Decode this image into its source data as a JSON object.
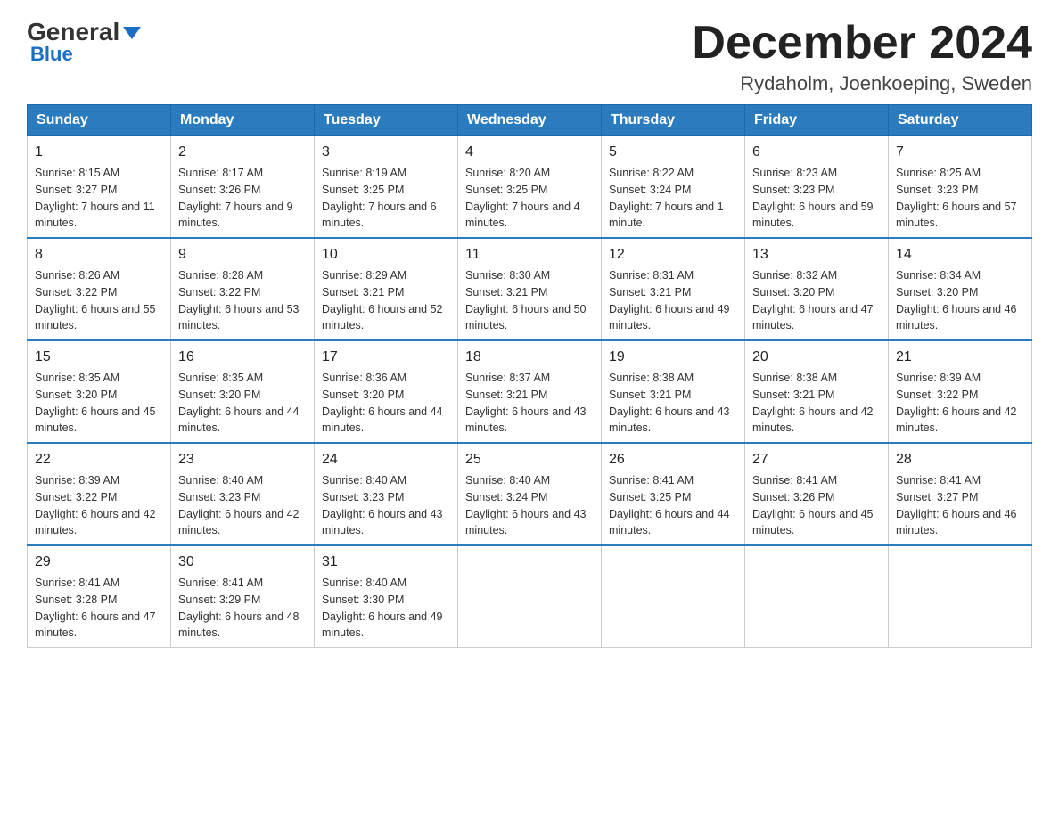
{
  "header": {
    "logo_general": "General",
    "logo_blue": "Blue",
    "main_title": "December 2024",
    "subtitle": "Rydaholm, Joenkoeping, Sweden"
  },
  "calendar": {
    "days_of_week": [
      "Sunday",
      "Monday",
      "Tuesday",
      "Wednesday",
      "Thursday",
      "Friday",
      "Saturday"
    ],
    "weeks": [
      [
        {
          "day": "1",
          "sunrise": "8:15 AM",
          "sunset": "3:27 PM",
          "daylight": "7 hours and 11 minutes."
        },
        {
          "day": "2",
          "sunrise": "8:17 AM",
          "sunset": "3:26 PM",
          "daylight": "7 hours and 9 minutes."
        },
        {
          "day": "3",
          "sunrise": "8:19 AM",
          "sunset": "3:25 PM",
          "daylight": "7 hours and 6 minutes."
        },
        {
          "day": "4",
          "sunrise": "8:20 AM",
          "sunset": "3:25 PM",
          "daylight": "7 hours and 4 minutes."
        },
        {
          "day": "5",
          "sunrise": "8:22 AM",
          "sunset": "3:24 PM",
          "daylight": "7 hours and 1 minute."
        },
        {
          "day": "6",
          "sunrise": "8:23 AM",
          "sunset": "3:23 PM",
          "daylight": "6 hours and 59 minutes."
        },
        {
          "day": "7",
          "sunrise": "8:25 AM",
          "sunset": "3:23 PM",
          "daylight": "6 hours and 57 minutes."
        }
      ],
      [
        {
          "day": "8",
          "sunrise": "8:26 AM",
          "sunset": "3:22 PM",
          "daylight": "6 hours and 55 minutes."
        },
        {
          "day": "9",
          "sunrise": "8:28 AM",
          "sunset": "3:22 PM",
          "daylight": "6 hours and 53 minutes."
        },
        {
          "day": "10",
          "sunrise": "8:29 AM",
          "sunset": "3:21 PM",
          "daylight": "6 hours and 52 minutes."
        },
        {
          "day": "11",
          "sunrise": "8:30 AM",
          "sunset": "3:21 PM",
          "daylight": "6 hours and 50 minutes."
        },
        {
          "day": "12",
          "sunrise": "8:31 AM",
          "sunset": "3:21 PM",
          "daylight": "6 hours and 49 minutes."
        },
        {
          "day": "13",
          "sunrise": "8:32 AM",
          "sunset": "3:20 PM",
          "daylight": "6 hours and 47 minutes."
        },
        {
          "day": "14",
          "sunrise": "8:34 AM",
          "sunset": "3:20 PM",
          "daylight": "6 hours and 46 minutes."
        }
      ],
      [
        {
          "day": "15",
          "sunrise": "8:35 AM",
          "sunset": "3:20 PM",
          "daylight": "6 hours and 45 minutes."
        },
        {
          "day": "16",
          "sunrise": "8:35 AM",
          "sunset": "3:20 PM",
          "daylight": "6 hours and 44 minutes."
        },
        {
          "day": "17",
          "sunrise": "8:36 AM",
          "sunset": "3:20 PM",
          "daylight": "6 hours and 44 minutes."
        },
        {
          "day": "18",
          "sunrise": "8:37 AM",
          "sunset": "3:21 PM",
          "daylight": "6 hours and 43 minutes."
        },
        {
          "day": "19",
          "sunrise": "8:38 AM",
          "sunset": "3:21 PM",
          "daylight": "6 hours and 43 minutes."
        },
        {
          "day": "20",
          "sunrise": "8:38 AM",
          "sunset": "3:21 PM",
          "daylight": "6 hours and 42 minutes."
        },
        {
          "day": "21",
          "sunrise": "8:39 AM",
          "sunset": "3:22 PM",
          "daylight": "6 hours and 42 minutes."
        }
      ],
      [
        {
          "day": "22",
          "sunrise": "8:39 AM",
          "sunset": "3:22 PM",
          "daylight": "6 hours and 42 minutes."
        },
        {
          "day": "23",
          "sunrise": "8:40 AM",
          "sunset": "3:23 PM",
          "daylight": "6 hours and 42 minutes."
        },
        {
          "day": "24",
          "sunrise": "8:40 AM",
          "sunset": "3:23 PM",
          "daylight": "6 hours and 43 minutes."
        },
        {
          "day": "25",
          "sunrise": "8:40 AM",
          "sunset": "3:24 PM",
          "daylight": "6 hours and 43 minutes."
        },
        {
          "day": "26",
          "sunrise": "8:41 AM",
          "sunset": "3:25 PM",
          "daylight": "6 hours and 44 minutes."
        },
        {
          "day": "27",
          "sunrise": "8:41 AM",
          "sunset": "3:26 PM",
          "daylight": "6 hours and 45 minutes."
        },
        {
          "day": "28",
          "sunrise": "8:41 AM",
          "sunset": "3:27 PM",
          "daylight": "6 hours and 46 minutes."
        }
      ],
      [
        {
          "day": "29",
          "sunrise": "8:41 AM",
          "sunset": "3:28 PM",
          "daylight": "6 hours and 47 minutes."
        },
        {
          "day": "30",
          "sunrise": "8:41 AM",
          "sunset": "3:29 PM",
          "daylight": "6 hours and 48 minutes."
        },
        {
          "day": "31",
          "sunrise": "8:40 AM",
          "sunset": "3:30 PM",
          "daylight": "6 hours and 49 minutes."
        },
        null,
        null,
        null,
        null
      ]
    ]
  }
}
